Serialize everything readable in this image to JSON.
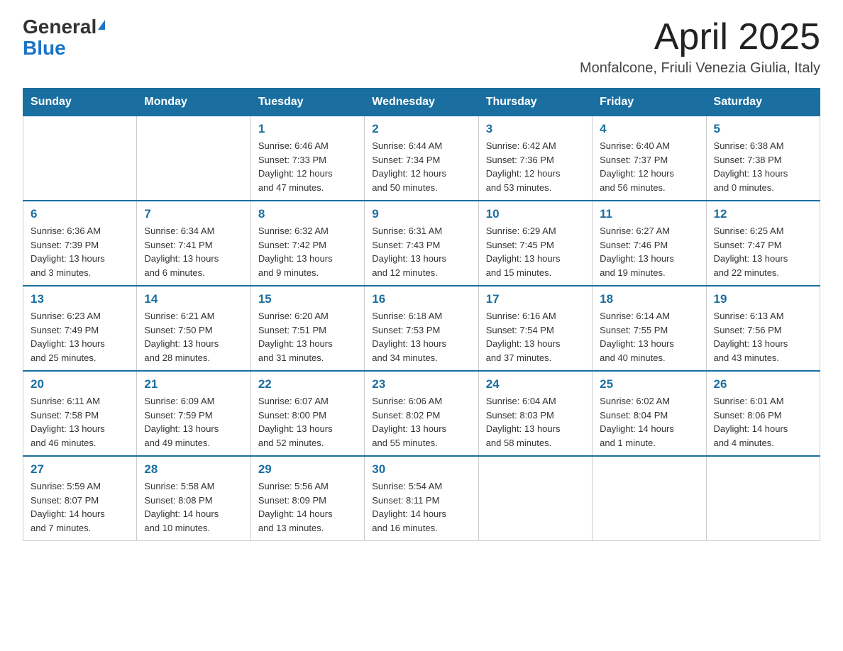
{
  "header": {
    "logo_general": "General",
    "logo_blue": "Blue",
    "month_title": "April 2025",
    "location": "Monfalcone, Friuli Venezia Giulia, Italy"
  },
  "days_of_week": [
    "Sunday",
    "Monday",
    "Tuesday",
    "Wednesday",
    "Thursday",
    "Friday",
    "Saturday"
  ],
  "weeks": [
    [
      {
        "day": "",
        "info": ""
      },
      {
        "day": "",
        "info": ""
      },
      {
        "day": "1",
        "info": "Sunrise: 6:46 AM\nSunset: 7:33 PM\nDaylight: 12 hours\nand 47 minutes."
      },
      {
        "day": "2",
        "info": "Sunrise: 6:44 AM\nSunset: 7:34 PM\nDaylight: 12 hours\nand 50 minutes."
      },
      {
        "day": "3",
        "info": "Sunrise: 6:42 AM\nSunset: 7:36 PM\nDaylight: 12 hours\nand 53 minutes."
      },
      {
        "day": "4",
        "info": "Sunrise: 6:40 AM\nSunset: 7:37 PM\nDaylight: 12 hours\nand 56 minutes."
      },
      {
        "day": "5",
        "info": "Sunrise: 6:38 AM\nSunset: 7:38 PM\nDaylight: 13 hours\nand 0 minutes."
      }
    ],
    [
      {
        "day": "6",
        "info": "Sunrise: 6:36 AM\nSunset: 7:39 PM\nDaylight: 13 hours\nand 3 minutes."
      },
      {
        "day": "7",
        "info": "Sunrise: 6:34 AM\nSunset: 7:41 PM\nDaylight: 13 hours\nand 6 minutes."
      },
      {
        "day": "8",
        "info": "Sunrise: 6:32 AM\nSunset: 7:42 PM\nDaylight: 13 hours\nand 9 minutes."
      },
      {
        "day": "9",
        "info": "Sunrise: 6:31 AM\nSunset: 7:43 PM\nDaylight: 13 hours\nand 12 minutes."
      },
      {
        "day": "10",
        "info": "Sunrise: 6:29 AM\nSunset: 7:45 PM\nDaylight: 13 hours\nand 15 minutes."
      },
      {
        "day": "11",
        "info": "Sunrise: 6:27 AM\nSunset: 7:46 PM\nDaylight: 13 hours\nand 19 minutes."
      },
      {
        "day": "12",
        "info": "Sunrise: 6:25 AM\nSunset: 7:47 PM\nDaylight: 13 hours\nand 22 minutes."
      }
    ],
    [
      {
        "day": "13",
        "info": "Sunrise: 6:23 AM\nSunset: 7:49 PM\nDaylight: 13 hours\nand 25 minutes."
      },
      {
        "day": "14",
        "info": "Sunrise: 6:21 AM\nSunset: 7:50 PM\nDaylight: 13 hours\nand 28 minutes."
      },
      {
        "day": "15",
        "info": "Sunrise: 6:20 AM\nSunset: 7:51 PM\nDaylight: 13 hours\nand 31 minutes."
      },
      {
        "day": "16",
        "info": "Sunrise: 6:18 AM\nSunset: 7:53 PM\nDaylight: 13 hours\nand 34 minutes."
      },
      {
        "day": "17",
        "info": "Sunrise: 6:16 AM\nSunset: 7:54 PM\nDaylight: 13 hours\nand 37 minutes."
      },
      {
        "day": "18",
        "info": "Sunrise: 6:14 AM\nSunset: 7:55 PM\nDaylight: 13 hours\nand 40 minutes."
      },
      {
        "day": "19",
        "info": "Sunrise: 6:13 AM\nSunset: 7:56 PM\nDaylight: 13 hours\nand 43 minutes."
      }
    ],
    [
      {
        "day": "20",
        "info": "Sunrise: 6:11 AM\nSunset: 7:58 PM\nDaylight: 13 hours\nand 46 minutes."
      },
      {
        "day": "21",
        "info": "Sunrise: 6:09 AM\nSunset: 7:59 PM\nDaylight: 13 hours\nand 49 minutes."
      },
      {
        "day": "22",
        "info": "Sunrise: 6:07 AM\nSunset: 8:00 PM\nDaylight: 13 hours\nand 52 minutes."
      },
      {
        "day": "23",
        "info": "Sunrise: 6:06 AM\nSunset: 8:02 PM\nDaylight: 13 hours\nand 55 minutes."
      },
      {
        "day": "24",
        "info": "Sunrise: 6:04 AM\nSunset: 8:03 PM\nDaylight: 13 hours\nand 58 minutes."
      },
      {
        "day": "25",
        "info": "Sunrise: 6:02 AM\nSunset: 8:04 PM\nDaylight: 14 hours\nand 1 minute."
      },
      {
        "day": "26",
        "info": "Sunrise: 6:01 AM\nSunset: 8:06 PM\nDaylight: 14 hours\nand 4 minutes."
      }
    ],
    [
      {
        "day": "27",
        "info": "Sunrise: 5:59 AM\nSunset: 8:07 PM\nDaylight: 14 hours\nand 7 minutes."
      },
      {
        "day": "28",
        "info": "Sunrise: 5:58 AM\nSunset: 8:08 PM\nDaylight: 14 hours\nand 10 minutes."
      },
      {
        "day": "29",
        "info": "Sunrise: 5:56 AM\nSunset: 8:09 PM\nDaylight: 14 hours\nand 13 minutes."
      },
      {
        "day": "30",
        "info": "Sunrise: 5:54 AM\nSunset: 8:11 PM\nDaylight: 14 hours\nand 16 minutes."
      },
      {
        "day": "",
        "info": ""
      },
      {
        "day": "",
        "info": ""
      },
      {
        "day": "",
        "info": ""
      }
    ]
  ]
}
